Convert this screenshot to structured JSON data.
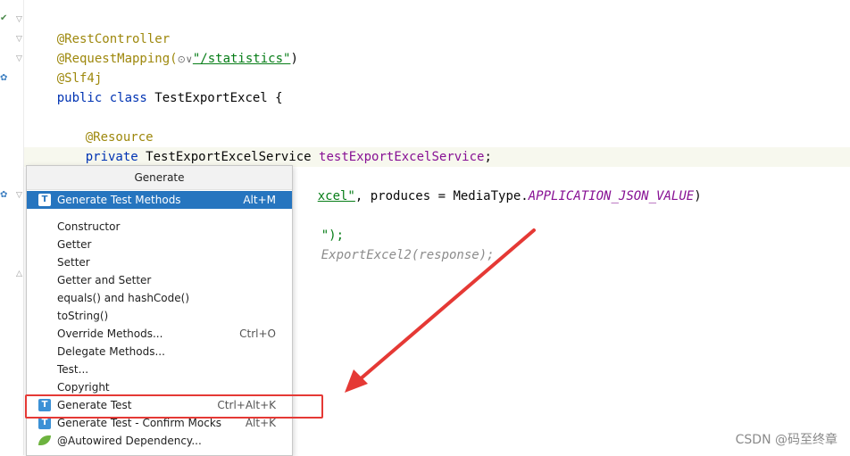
{
  "editor": {
    "lines": {
      "l1_ann": "@RestController",
      "l2_ann": "@RequestMapping(",
      "l2_globe": "⊙∨",
      "l2_str": "\"/statistics\"",
      "l2_close": ")",
      "l3_ann": "@Slf4j",
      "l4_kw": "public class ",
      "l4_name": "TestExportExcel {",
      "l5_ann": "@Resource",
      "l6_kw": "private ",
      "l6_type": "TestExportExcelService ",
      "l6_field": "testExportExcelService",
      "l6_semi": ";",
      "l7_str": "xcel\"",
      "l7_mid": ", produces = MediaType.",
      "l7_const": "APPLICATION_JSON_VALUE",
      "l7_close": ")",
      "l8_text": "\");",
      "l9_text": "ExportExcel2(response);"
    }
  },
  "popup": {
    "title": "Generate",
    "items": [
      {
        "label": "Generate Test Methods",
        "shortcut": "Alt+M",
        "icon": "test-icon"
      },
      {
        "label": "Constructor",
        "shortcut": ""
      },
      {
        "label": "Getter",
        "shortcut": ""
      },
      {
        "label": "Setter",
        "shortcut": ""
      },
      {
        "label": "Getter and Setter",
        "shortcut": ""
      },
      {
        "label": "equals() and hashCode()",
        "shortcut": ""
      },
      {
        "label": "toString()",
        "shortcut": ""
      },
      {
        "label": "Override Methods...",
        "shortcut": "Ctrl+O"
      },
      {
        "label": "Delegate Methods...",
        "shortcut": ""
      },
      {
        "label": "Test...",
        "shortcut": ""
      },
      {
        "label": "Copyright",
        "shortcut": ""
      },
      {
        "label": "Generate Test",
        "shortcut": "Ctrl+Alt+K",
        "icon": "test-icon"
      },
      {
        "label": "Generate Test - Confirm Mocks",
        "shortcut": "Alt+K",
        "icon": "test-icon"
      },
      {
        "label": "@Autowired Dependency...",
        "shortcut": "",
        "icon": "spring-leaf-icon"
      }
    ],
    "selected_index": 0,
    "test_icon_glyph": "T"
  },
  "annotation": {
    "highlight_color": "#e53935"
  },
  "watermark": "CSDN @码至终章"
}
